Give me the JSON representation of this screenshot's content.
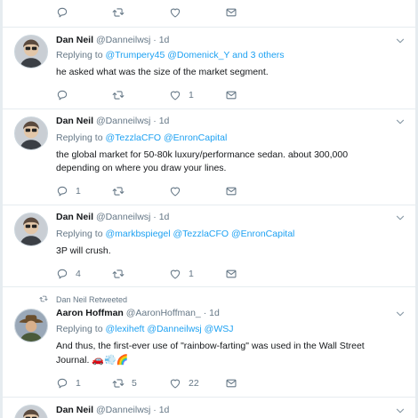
{
  "top_actions": {
    "reply": "",
    "retweet": "",
    "like": ""
  },
  "tweets": [
    {
      "name": "Dan Neil",
      "handle": "@Danneilwsj",
      "dot": "·",
      "time": "1d",
      "replying_prefix": "Replying to",
      "mentions": [
        "@Trumpery45",
        "@Domenick_Y"
      ],
      "replying_suffix": "and 3 others",
      "text": "he asked what was the size of the market segment.",
      "reply_count": "",
      "retweet_count": "",
      "like_count": "1"
    },
    {
      "name": "Dan Neil",
      "handle": "@Danneilwsj",
      "dot": "·",
      "time": "1d",
      "replying_prefix": "Replying to",
      "mentions": [
        "@TezzlaCFO",
        "@EnronCapital"
      ],
      "text": "the global market for 50-80k luxury/performance sedan. about 300,000 depending on where you draw your lines.",
      "reply_count": "1",
      "retweet_count": "",
      "like_count": ""
    },
    {
      "name": "Dan Neil",
      "handle": "@Danneilwsj",
      "dot": "·",
      "time": "1d",
      "replying_prefix": "Replying to",
      "mentions": [
        "@markbspiegel",
        "@TezzlaCFO",
        "@EnronCapital"
      ],
      "text": "3P will crush.",
      "reply_count": "4",
      "retweet_count": "",
      "like_count": "1"
    },
    {
      "retweet_context": "Dan Neil Retweeted",
      "name": "Aaron Hoffman",
      "handle": "@AaronHoffman_",
      "dot": "·",
      "time": "1d",
      "replying_prefix": "Replying to",
      "mentions": [
        "@lexiheft",
        "@Danneilwsj",
        "@WSJ"
      ],
      "text": "And thus, the first-ever use of \"rainbow-farting\" was used in the Wall Street Journal.",
      "emoji": "🚗💨🌈",
      "reply_count": "1",
      "retweet_count": "5",
      "like_count": "22"
    },
    {
      "name": "Dan Neil",
      "handle": "@Danneilwsj",
      "dot": "·",
      "time": "1d"
    }
  ],
  "icons": {
    "reply": "reply-icon",
    "retweet": "retweet-icon",
    "like": "heart-icon",
    "dm": "envelope-icon",
    "more": "chevron-down-icon"
  },
  "colors": {
    "link": "#1da1f2",
    "muted": "#657786",
    "text": "#14171a",
    "border": "#e6ecf0"
  }
}
